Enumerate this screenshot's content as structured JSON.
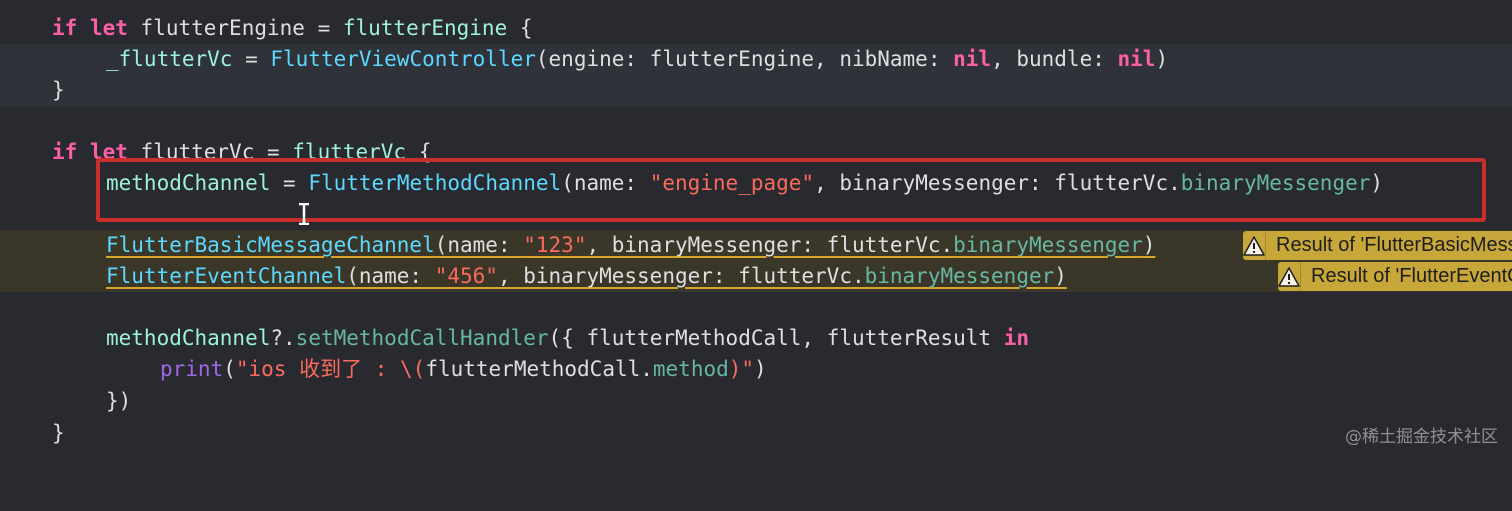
{
  "lines": {
    "l1": {
      "kw_if": "if",
      "kw_let": "let",
      "name": "flutterEngine",
      "eq": " = ",
      "val": "flutterEngine",
      "brace": " {"
    },
    "l2": {
      "var": "_flutterVc",
      "eq": " = ",
      "type": "FlutterViewController",
      "args_a": "(engine: flutterEngine, nibName: ",
      "nil1": "nil",
      "args_b": ", bundle: ",
      "nil2": "nil",
      "close": ")"
    },
    "l3": {
      "text": "}"
    },
    "l5": {
      "kw_if": "if",
      "kw_let": "let",
      "name": "flutterVc",
      "eq": " = ",
      "val": "flutterVc",
      "brace": " {"
    },
    "l6": {
      "var": "methodChannel",
      "eq": " = ",
      "type": "FlutterMethodChannel",
      "args_a": "(name: ",
      "str": "\"engine_page\"",
      "args_b": ", binaryMessenger: flutterVc.",
      "prop": "binaryMessenger",
      "close": ")"
    },
    "l8": {
      "type": "FlutterBasicMessageChannel",
      "args_a": "(name: ",
      "str": "\"123\"",
      "args_b": ", binaryMessenger: flutterVc.",
      "prop": "binaryMessenger",
      "close": ")"
    },
    "l9": {
      "type": "FlutterEventChannel",
      "args_a": "(name: ",
      "str": "\"456\"",
      "args_b": ", binaryMessenger: flutterVc.",
      "prop": "binaryMessenger",
      "close": ")"
    },
    "l11": {
      "var": "methodChannel",
      "opt": "?.",
      "fn": "setMethodCallHandler",
      "rest": "({ flutterMethodCall, flutterResult ",
      "kw_in": "in"
    },
    "l12": {
      "fn": "print",
      "open": "(",
      "str_a": "\"ios 收到了 : \\(",
      "mid": "flutterMethodCall.",
      "prop": "method",
      "str_b": ")\"",
      "close": ")"
    },
    "l13": {
      "text": "})"
    },
    "l14": {
      "text": "}"
    }
  },
  "warnings": [
    {
      "text": "Result of 'FlutterBasicMessageChannel'"
    },
    {
      "text": "Result of 'FlutterEventChannel'"
    }
  ],
  "icons": {
    "warning": "warning-triangle-icon",
    "cursor": "text-cursor-icon"
  },
  "colors": {
    "background": "#292a30",
    "keyword": "#fc5fa3",
    "string": "#fc6a5d",
    "type": "#5dd8ff",
    "warning": "#c7a73a",
    "highlight_box": "#c9302c"
  },
  "watermark": "@稀土掘金技术社区"
}
